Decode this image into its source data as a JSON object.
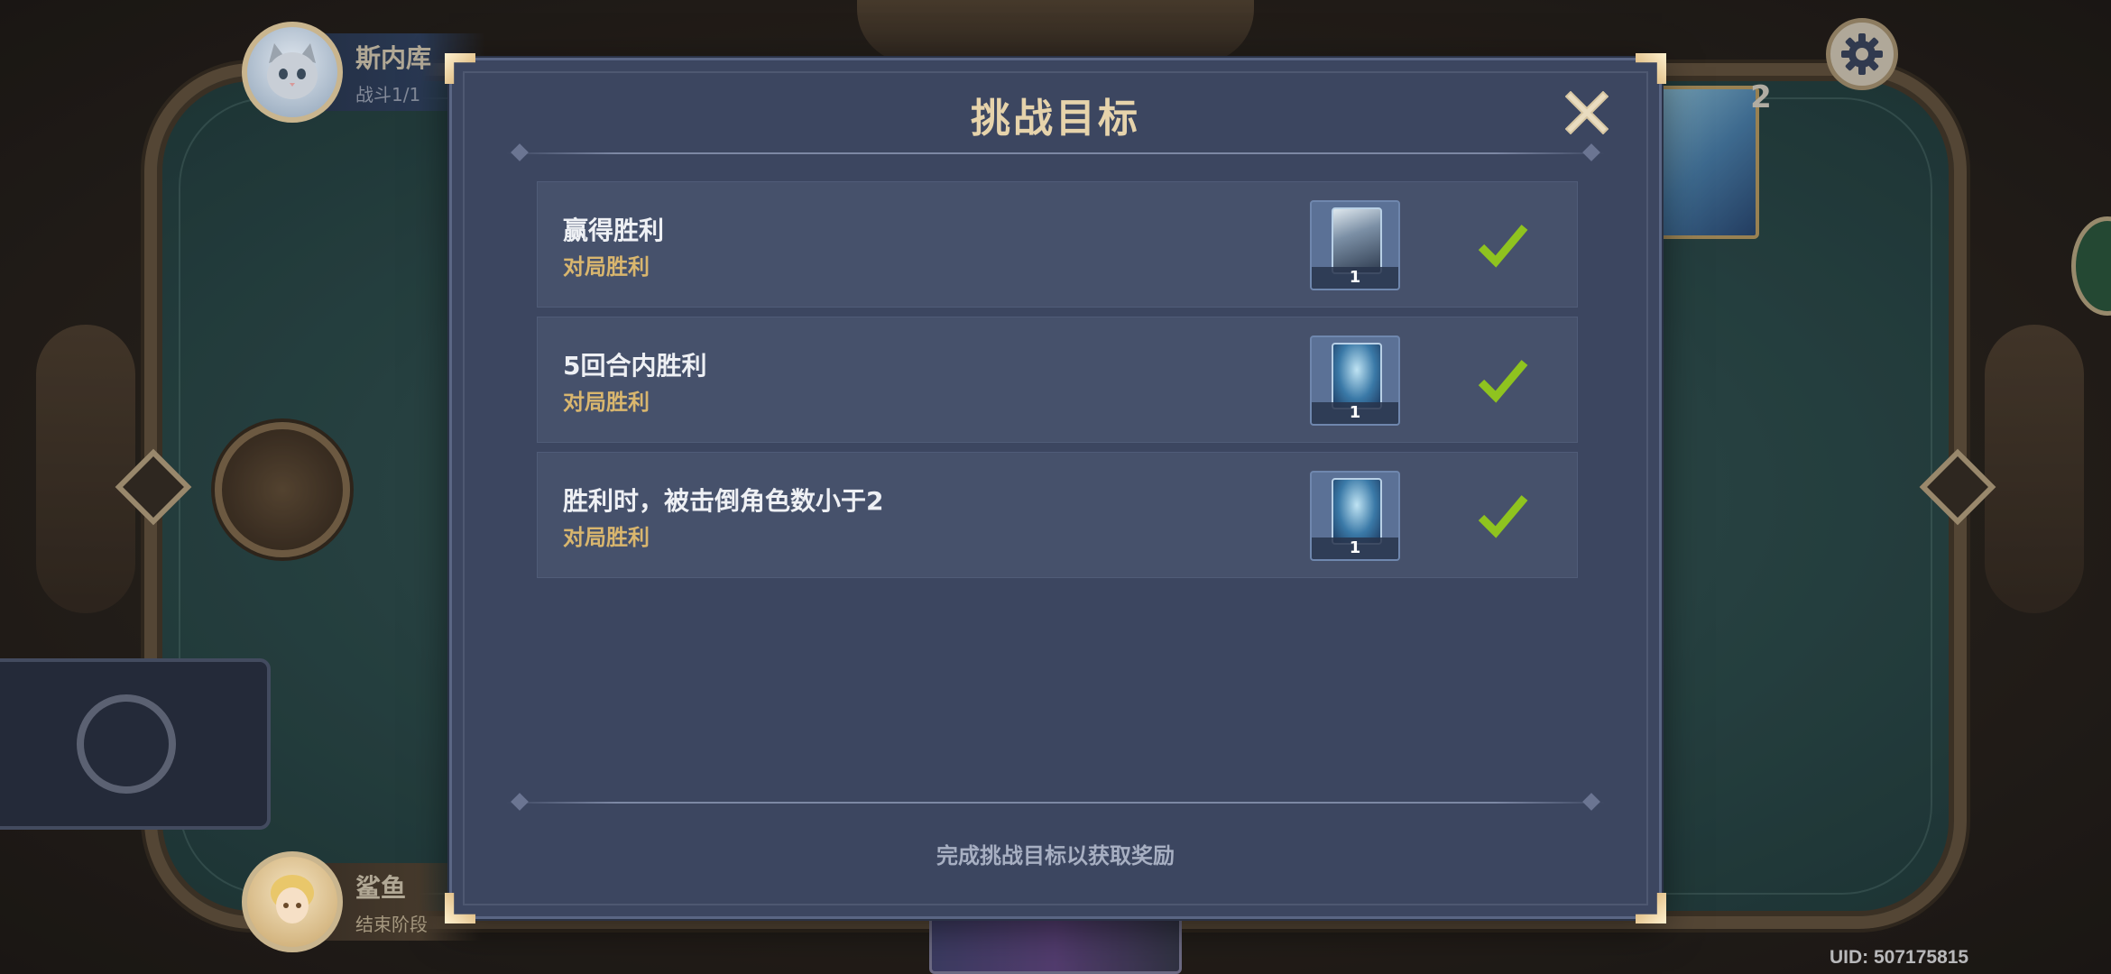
{
  "players": {
    "opponent": {
      "name": "斯内库",
      "status": "战斗1/1",
      "avatar_icon": "cat-avatar-icon"
    },
    "self": {
      "name": "鲨鱼",
      "status": "结束阶段",
      "avatar_icon": "character-avatar-icon"
    }
  },
  "opponent_card": {
    "count": "2"
  },
  "modal": {
    "title": "挑战目标",
    "close_icon": "close-icon",
    "goals": [
      {
        "title": "赢得胜利",
        "condition": "对局胜利",
        "reward_count": "1",
        "reward_type": "character-card",
        "completed": true
      },
      {
        "title": "5回合内胜利",
        "condition": "对局胜利",
        "reward_count": "1",
        "reward_type": "card-back",
        "completed": true
      },
      {
        "title": "胜利时，被击倒角色数小于2",
        "condition": "对局胜利",
        "reward_count": "1",
        "reward_type": "card-back",
        "completed": true
      }
    ],
    "footer_hint": "完成挑战目标以获取奖励"
  },
  "uid": "UID: 507175815",
  "colors": {
    "modal_bg": "#3c4660",
    "title_gold": "#e6d3ab",
    "condition_gold": "#d9b66e",
    "check_green": "#8fc31f"
  }
}
